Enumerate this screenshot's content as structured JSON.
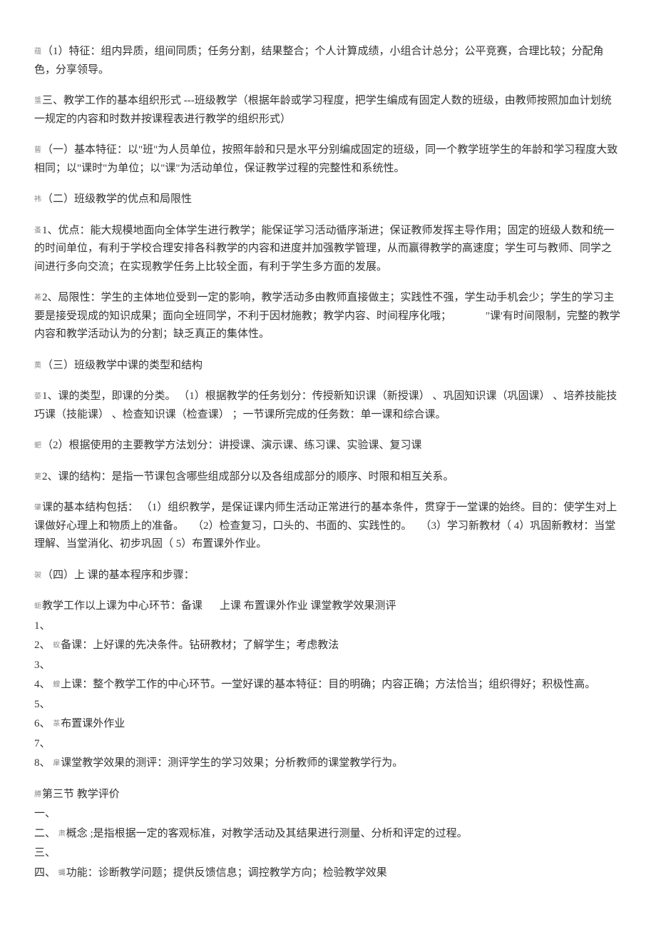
{
  "p1": "（1）特征：组内异质，组间同质；任务分割，结果整合；个人计算成绩，小组合计总分；公平竞赛，合理比较；分配角色，分享领导。",
  "p2": "三、教学工作的基本组织形式 ---班级教学（根据年龄或学习程度，把学生编成有固定人数的班级，由教师按照加血计划统一规定的内容和时数并按课程表进行教学的组织形式）",
  "p3": "（一）基本特征：以\"班\"为人员单位，按照年龄和只是水平分别编成固定的班级，同一个教学班学生的年龄和学习程度大致相同；以\"课时\"为单位；以\"课\"为活动单位，保证教学过程的完整性和系统性。",
  "p4": "（二）班级教学的优点和局限性",
  "p5": "1、优点：能大规模地面向全体学生进行教学；能保证学习活动循序渐进；保证教师发挥主导作用；固定的班级人数和统一的时间单位，有利于学校合理安排各科教学的内容和进度并加强教学管理，从而赢得教学的高速度；学生可与教师、同学之间进行多向交流；在实现教学任务上比较全面，有利于学生多方面的发展。",
  "p6_a": "2、局限性：学生的主体地位受到一定的影响，教学活动多由教师直接做主；实践性不强，学生动手机会少；学生的学习主要是接受现成的知识成果；面向全班同学，不利于因材施教；教学内容、时间程序化哦；",
  "p6_b": "\"课'有时间限制，完整的教学内容和教学活动认为的分割；缺乏真正的集体性。",
  "p7": "（三）班级教学中课的类型和结构",
  "p8": "1、课的类型，即课的分类。 （1）根据教学的任务划分：传授新知识课（新授课） 、巩固知识课（巩固课） 、培养技能技巧课（技能课） 、检查知识课（检查课） ；一节课所完成的任务数：单一课和综合课。",
  "p9": "（2）根据使用的主要教学方法划分：讲授课、演示课、练习课、实验课、复习课",
  "p10": "2、课的结构：是指一节课包含哪些组成部分以及各组成部分的顺序、时限和相互关系。",
  "p11_a": "课的基本结构包括： （1）组织教学，是保证课内师生活动正常进行的基本条件，贯穿于一堂课的始终。目的：使学生对上课做好心理上和物质上的准备。",
  "p11_b": "（2）检查复习，口头的、书面的、实践性的。",
  "p11_c": "（3）学习新教材（   4）巩固新教材：当堂理解、当堂消化、初步巩固（     5）布置课外作业。",
  "p12": "（四）上  课的基本程序和步骤：",
  "p13_a": "教学工作以上课为中心环节：备课",
  "p13_b": "上课   布置课外作业    课堂教学效果测评",
  "list1_1": "1、",
  "list1_2a": "2、",
  "list1_2b": "备课：上好课的先决条件。钻研教材；了解学生；考虑教法",
  "list1_3": "3、",
  "list1_4a": "4、",
  "list1_4b": "上课：整个教学工作的中心环节。一堂好课的基本特征：目的明确；内容正确；方法恰当；组织得好；积极性高。",
  "list1_5": "5、",
  "list1_6a": "6、",
  "list1_6b": "布置课外作业",
  "list1_7": "7、",
  "list1_8a": "8、",
  "list1_8b": "课堂教学效果的测评：测评学生的学习效果；分析教师的课堂教学行为。",
  "p14": "第三节   教学评价",
  "list2_1": "一、",
  "list2_2a": "二、",
  "list2_2b": "概念 ;是指根据一定的客观标准，对教学活动及其结果进行测量、分析和评定的过程。",
  "list2_3": "三、",
  "list2_4a": "四、",
  "list2_4b": "功能：诊断教学问题；提供反馈信息；调控教学方向；检验教学效果",
  "pre": {
    "p1": "蕴",
    "p2": "螀",
    "p3": "蒈",
    "p4": "袆",
    "p5": "蚤",
    "p6": "莃",
    "p7": "薁",
    "p8": "蒆",
    "p9": "蚆",
    "p10": "莄",
    "p11": "肇",
    "p12": "袈",
    "p13": "蚅",
    "l2b": "蚁",
    "l4b": "螋",
    "l6b": "蒃",
    "l8b": "肁",
    "p14": "膊",
    "r2b": "肃",
    "r4b": "蝿"
  }
}
